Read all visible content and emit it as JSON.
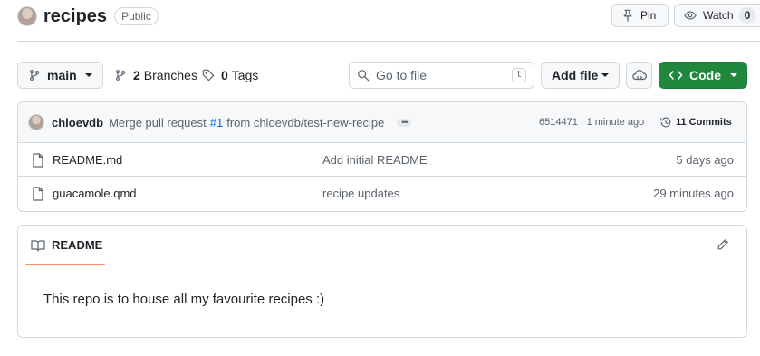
{
  "repo": {
    "name": "recipes",
    "visibility": "Public"
  },
  "header": {
    "pin_label": "Pin",
    "watch_label": "Watch",
    "watch_count": "0"
  },
  "toolbar": {
    "branch": "main",
    "branches_count": "2",
    "branches_label": "Branches",
    "tags_count": "0",
    "tags_label": "Tags",
    "search_placeholder": "Go to file",
    "search_shortcut": "t",
    "add_file_label": "Add file",
    "code_label": "Code"
  },
  "commit": {
    "author": "chloevdb",
    "message_prefix": "Merge pull request",
    "pr_ref": "#1",
    "message_suffix": "from chloevdb/test-new-recipe",
    "meta": "6514471 · 1 minute ago",
    "commits_label": "11 Commits"
  },
  "files": [
    {
      "name": "README.md",
      "commit": "Add initial README",
      "time": "5 days ago"
    },
    {
      "name": "guacamole.qmd",
      "commit": "recipe updates",
      "time": "29 minutes ago"
    }
  ],
  "readme": {
    "tab_label": "README",
    "text": "This repo is to house all my favourite recipes :)"
  },
  "colors": {
    "code_button": "#1f883d",
    "link": "#0969da",
    "tab_underline": "#fd8c73",
    "border": "#d1d9e0"
  },
  "icons": [
    "pin-icon",
    "eye-icon",
    "branch-icon",
    "tag-icon",
    "search-icon",
    "codespaces-icon",
    "code-icon",
    "history-icon",
    "file-icon",
    "book-icon",
    "pencil-icon"
  ]
}
